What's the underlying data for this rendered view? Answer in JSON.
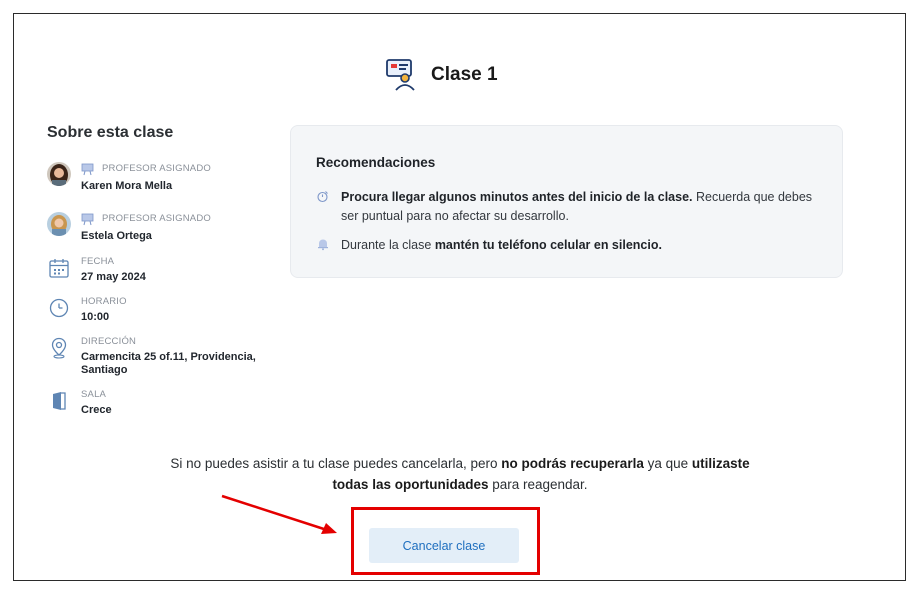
{
  "page": {
    "title": "Clase 1",
    "title_icon": "teacher-presentation-icon"
  },
  "about": {
    "heading": "Sobre esta clase",
    "teachers": [
      {
        "label": "PROFESOR ASIGNADO",
        "name": "Karen Mora Mella",
        "icon": "board-icon"
      },
      {
        "label": "PROFESOR ASIGNADO",
        "name": "Estela Ortega",
        "icon": "board-icon"
      }
    ],
    "date": {
      "label": "FECHA",
      "value": "27 may 2024",
      "icon": "calendar-icon"
    },
    "time": {
      "label": "HORARIO",
      "value": "10:00",
      "icon": "clock-icon"
    },
    "address": {
      "label": "DIRECCIÓN",
      "line1": "Carmencita 25 of.11, Providencia,",
      "line2": "Santiago",
      "icon": "location-pin-icon"
    },
    "room": {
      "label": "SALA",
      "value": "Crece",
      "icon": "door-icon"
    }
  },
  "recommendations": {
    "title": "Recomendaciones",
    "items": [
      {
        "icon": "stopwatch-icon",
        "bold": "Procura llegar algunos minutos antes del inicio de la clase.",
        "rest": " Recuerda que debes ser puntual para no afectar su desarrollo."
      },
      {
        "icon": "bell-icon",
        "pre": "Durante la clase ",
        "bold": "mantén tu teléfono celular en silencio."
      }
    ]
  },
  "notice": {
    "part1": "Si no puedes asistir a tu clase puedes cancelarla, pero ",
    "bold1": "no podrás recuperarla",
    "part2": " ya que ",
    "bold2a": "utilizaste",
    "bold2b": "todas las oportunidades",
    "part3": " para reagendar."
  },
  "actions": {
    "cancel_label": "Cancelar clase"
  },
  "colors": {
    "accent": "#1f6fbf",
    "button_bg": "#e3eef8",
    "highlight": "#e40000",
    "card_bg": "#f4f6f8"
  }
}
